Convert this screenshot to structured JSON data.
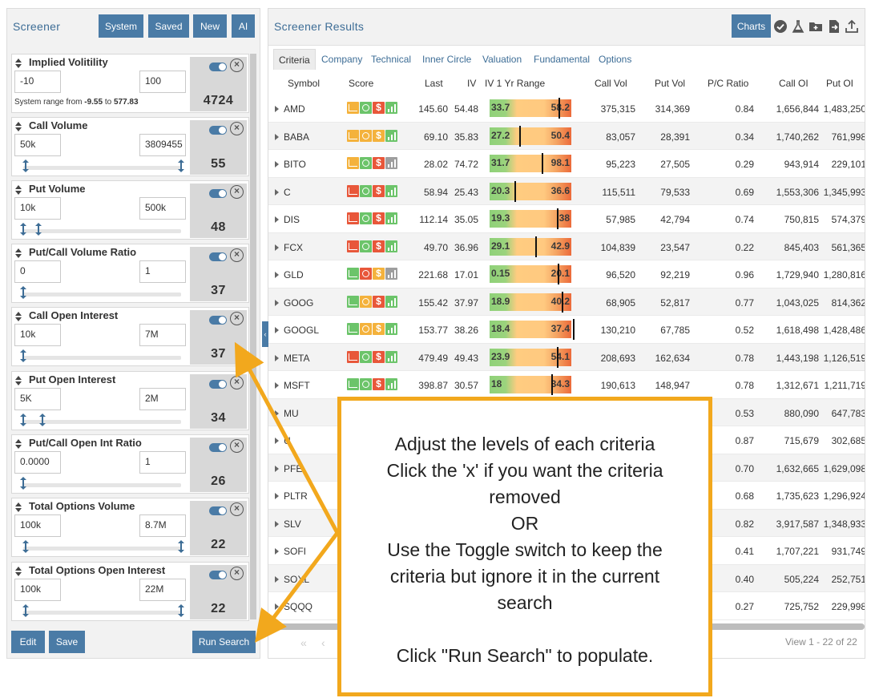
{
  "screener": {
    "title": "Screener",
    "buttons": [
      "System",
      "Saved",
      "New",
      "AI"
    ],
    "criteria": [
      {
        "name": "Implied Volitility",
        "min": "-10",
        "max": "100",
        "count": "4724",
        "system_range": {
          "prefix": "System range from",
          "low": "-9.55",
          "mid": "to",
          "high": "577.83"
        }
      },
      {
        "name": "Call Volume",
        "min": "50k",
        "max": "3809455",
        "count": "55"
      },
      {
        "name": "Put Volume",
        "min": "10k",
        "max": "500k",
        "count": "48"
      },
      {
        "name": "Put/Call Volume Ratio",
        "min": "0",
        "max": "1",
        "count": "37"
      },
      {
        "name": "Call Open Interest",
        "min": "10k",
        "max": "7M",
        "count": "37"
      },
      {
        "name": "Put Open Interest",
        "min": "5K",
        "max": "2M",
        "count": "34"
      },
      {
        "name": "Put/Call Open Int Ratio",
        "min": "0.0000",
        "max": "1",
        "count": "26"
      },
      {
        "name": "Total Options Volume",
        "min": "100k",
        "max": "8.7M",
        "count": "22"
      },
      {
        "name": "Total Options Open Interest",
        "min": "100k",
        "max": "22M",
        "count": "22"
      }
    ],
    "footer": {
      "edit": "Edit",
      "save": "Save",
      "run": "Run Search"
    }
  },
  "results": {
    "title": "Screener Results",
    "charts_label": "Charts",
    "toolbar_icons": [
      "check-circle-icon",
      "flask-icon",
      "folder-add-icon",
      "file-export-icon",
      "upload-icon"
    ],
    "tabs": [
      "Criteria",
      "Company",
      "Technical",
      "Inner Circle",
      "Valuation",
      "Fundamental",
      "Options"
    ],
    "columns": [
      "Symbol",
      "Score",
      "Last",
      "IV",
      "IV 1 Yr Range",
      "Call Vol",
      "Put Vol",
      "P/C Ratio",
      "Call OI",
      "Put OI"
    ],
    "rows": [
      {
        "symbol": "AMD",
        "last": "145.60",
        "iv": "54.48",
        "lo": "33.7",
        "hi": "58.2",
        "call_vol": "375,315",
        "put_vol": "314,369",
        "pc": "0.84",
        "call_oi": "1,656,844",
        "put_oi": "1,483,250",
        "iv_pos": 0.86
      },
      {
        "symbol": "BABA",
        "last": "69.10",
        "iv": "35.83",
        "lo": "27.2",
        "hi": "50.4",
        "call_vol": "83,057",
        "put_vol": "28,391",
        "pc": "0.34",
        "call_oi": "1,740,262",
        "put_oi": "761,998",
        "iv_pos": 0.37
      },
      {
        "symbol": "BITO",
        "last": "28.02",
        "iv": "74.72",
        "lo": "31.7",
        "hi": "98.1",
        "call_vol": "95,223",
        "put_vol": "27,505",
        "pc": "0.29",
        "call_oi": "943,914",
        "put_oi": "229,101",
        "iv_pos": 0.65
      },
      {
        "symbol": "C",
        "last": "58.94",
        "iv": "25.43",
        "lo": "20.3",
        "hi": "36.6",
        "call_vol": "115,511",
        "put_vol": "79,533",
        "pc": "0.69",
        "call_oi": "1,553,306",
        "put_oi": "1,345,993",
        "iv_pos": 0.31
      },
      {
        "symbol": "DIS",
        "last": "112.14",
        "iv": "35.05",
        "lo": "19.3",
        "hi": "38",
        "call_vol": "57,985",
        "put_vol": "42,794",
        "pc": "0.74",
        "call_oi": "750,815",
        "put_oi": "574,379",
        "iv_pos": 0.84
      },
      {
        "symbol": "FCX",
        "last": "49.70",
        "iv": "36.96",
        "lo": "29.1",
        "hi": "42.9",
        "call_vol": "104,839",
        "put_vol": "23,547",
        "pc": "0.22",
        "call_oi": "845,403",
        "put_oi": "561,365",
        "iv_pos": 0.57
      },
      {
        "symbol": "GLD",
        "last": "221.68",
        "iv": "17.01",
        "lo": "0.15",
        "hi": "20.1",
        "call_vol": "96,520",
        "put_vol": "92,219",
        "pc": "0.96",
        "call_oi": "1,729,940",
        "put_oi": "1,280,816",
        "iv_pos": 0.85
      },
      {
        "symbol": "GOOG",
        "last": "155.42",
        "iv": "37.97",
        "lo": "18.9",
        "hi": "40.2",
        "call_vol": "68,905",
        "put_vol": "52,817",
        "pc": "0.77",
        "call_oi": "1,043,025",
        "put_oi": "814,362",
        "iv_pos": 0.9
      },
      {
        "symbol": "GOOGL",
        "last": "153.77",
        "iv": "38.26",
        "lo": "18.4",
        "hi": "37.4",
        "call_vol": "130,210",
        "put_vol": "67,785",
        "pc": "0.52",
        "call_oi": "1,618,498",
        "put_oi": "1,428,486",
        "iv_pos": 1.04
      },
      {
        "symbol": "META",
        "last": "479.49",
        "iv": "49.43",
        "lo": "23.9",
        "hi": "54.1",
        "call_vol": "208,693",
        "put_vol": "162,634",
        "pc": "0.78",
        "call_oi": "1,443,198",
        "put_oi": "1,126,519",
        "iv_pos": 0.84
      },
      {
        "symbol": "MSFT",
        "last": "398.87",
        "iv": "30.57",
        "lo": "18",
        "hi": "34.3",
        "call_vol": "190,613",
        "put_vol": "148,947",
        "pc": "0.78",
        "call_oi": "1,312,671",
        "put_oi": "1,211,719",
        "iv_pos": 0.77
      },
      {
        "symbol": "MU",
        "last": "",
        "iv": "",
        "lo": "",
        "hi": "",
        "call_vol": "",
        "put_vol": "",
        "pc": "0.53",
        "call_oi": "880,090",
        "put_oi": "647,783",
        "iv_pos": null
      },
      {
        "symbol": "U",
        "last": "",
        "iv": "",
        "lo": "",
        "hi": "",
        "call_vol": "",
        "put_vol": "",
        "pc": "0.87",
        "call_oi": "715,679",
        "put_oi": "302,685",
        "iv_pos": null
      },
      {
        "symbol": "PFE",
        "last": "",
        "iv": "",
        "lo": "",
        "hi": "",
        "call_vol": "",
        "put_vol": "",
        "pc": "0.70",
        "call_oi": "1,632,665",
        "put_oi": "1,629,098",
        "iv_pos": null
      },
      {
        "symbol": "PLTR",
        "last": "",
        "iv": "",
        "lo": "",
        "hi": "",
        "call_vol": "",
        "put_vol": "",
        "pc": "0.68",
        "call_oi": "1,735,623",
        "put_oi": "1,296,924",
        "iv_pos": null
      },
      {
        "symbol": "SLV",
        "last": "",
        "iv": "",
        "lo": "",
        "hi": "",
        "call_vol": "",
        "put_vol": "",
        "pc": "0.82",
        "call_oi": "3,917,587",
        "put_oi": "1,348,933",
        "iv_pos": null
      },
      {
        "symbol": "SOFI",
        "last": "",
        "iv": "",
        "lo": "",
        "hi": "",
        "call_vol": "",
        "put_vol": "",
        "pc": "0.41",
        "call_oi": "1,707,221",
        "put_oi": "931,749",
        "iv_pos": null
      },
      {
        "symbol": "SOXL",
        "last": "",
        "iv": "",
        "lo": "",
        "hi": "",
        "call_vol": "",
        "put_vol": "",
        "pc": "0.40",
        "call_oi": "505,224",
        "put_oi": "252,751",
        "iv_pos": null
      },
      {
        "symbol": "SQQQ",
        "last": "",
        "iv": "",
        "lo": "",
        "hi": "",
        "call_vol": "",
        "put_vol": "",
        "pc": "0.27",
        "call_oi": "725,752",
        "put_oi": "229,998",
        "iv_pos": null
      }
    ],
    "view_info": "View 1 - 22 of 22"
  },
  "callout": {
    "lines": [
      "Adjust the levels of each criteria",
      "Click the 'x' if you want the criteria",
      "removed",
      "OR",
      "Use the Toggle switch to keep the",
      "criteria but ignore it in the current",
      "search",
      "",
      "Click \"Run Search\" to populate."
    ]
  },
  "colors": {
    "accent": "#4a7ba6",
    "callout_border": "#f2a81d",
    "score_green": "#6cc46a",
    "score_orange": "#f4b23c",
    "score_red": "#e8573a",
    "score_gray": "#9e9e9e"
  }
}
